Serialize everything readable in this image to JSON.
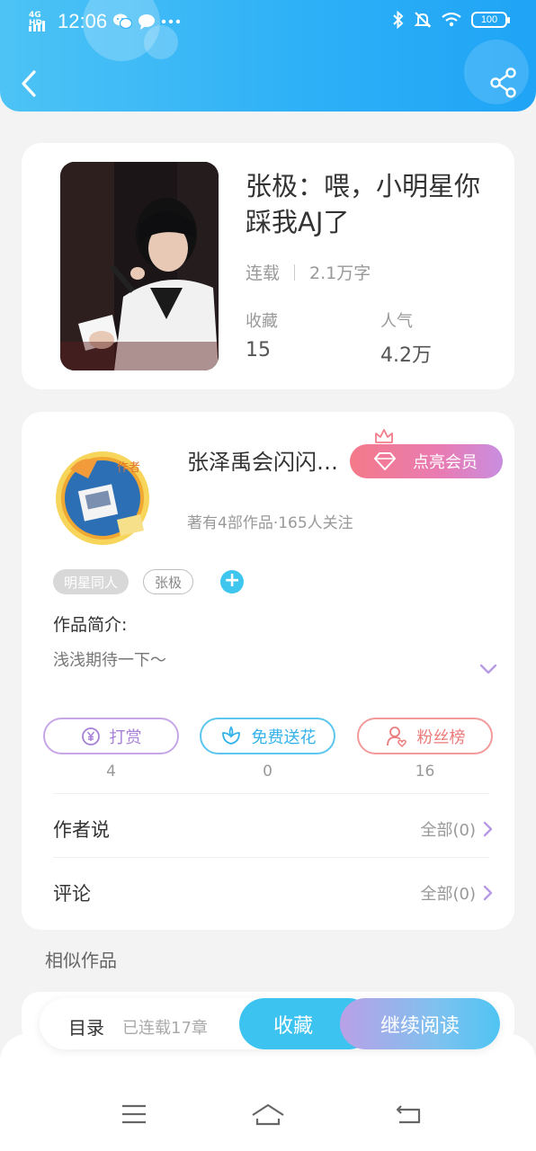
{
  "status_bar": {
    "network": "4G HD",
    "time": "12:06",
    "battery": "100"
  },
  "book": {
    "title": "张极：喂，小明星你踩我AJ了",
    "status": "连载",
    "word_count": "2.1万字",
    "favorites_label": "收藏",
    "favorites_value": "15",
    "popularity_label": "人气",
    "popularity_value": "4.2万"
  },
  "author": {
    "name": "张泽禹会闪闪…",
    "vip_label": "点亮会员",
    "info": "著有4部作品·165人关注",
    "avatar_badge": "作者"
  },
  "tags": [
    "明星同人",
    "张极"
  ],
  "intro": {
    "label": "作品简介:",
    "text": "浅浅期待一下～"
  },
  "actions": [
    {
      "label": "打赏",
      "count": "4",
      "icon": "yen-coin-icon",
      "color": "#a77fd8"
    },
    {
      "label": "免费送花",
      "count": "0",
      "icon": "flower-icon",
      "color": "#33b2ea"
    },
    {
      "label": "粉丝榜",
      "count": "16",
      "icon": "fan-user-icon",
      "color": "#ec7b7b"
    }
  ],
  "rows": {
    "author_says_label": "作者说",
    "author_says_value": "全部(0)",
    "comments_label": "评论",
    "comments_value": "全部(0)"
  },
  "similar_label": "相似作品",
  "bottom_bar": {
    "toc_label": "目录",
    "toc_count": "已连载17章",
    "favorite_label": "收藏",
    "read_label": "继续阅读"
  },
  "colors": {
    "header_blue": "#2fb1f7",
    "accent_cyan": "#3cc3ef",
    "vip_pink": "#f47a8a"
  }
}
